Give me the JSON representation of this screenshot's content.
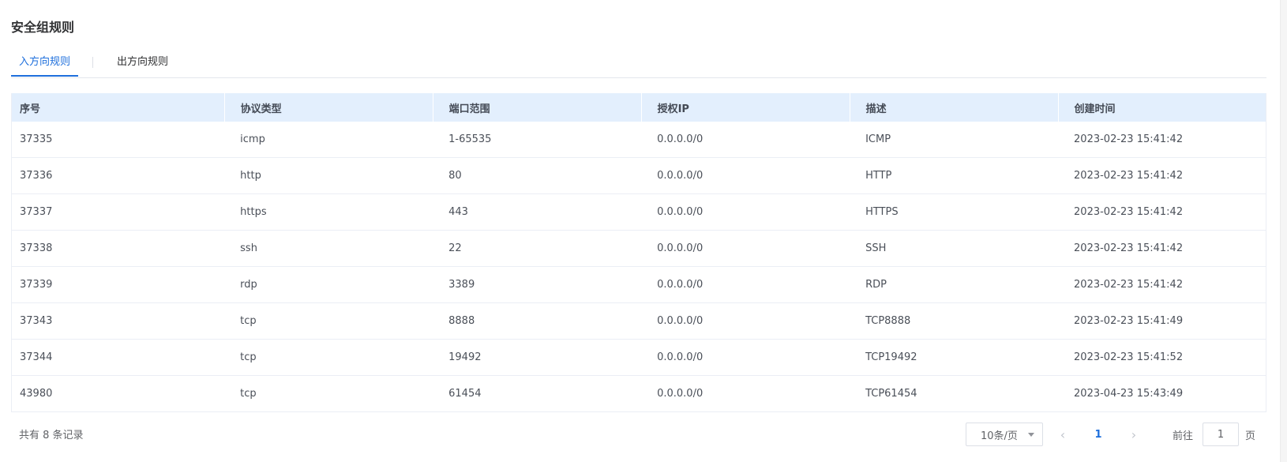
{
  "section": {
    "title": "安全组规则"
  },
  "tabs": [
    {
      "label": "入方向规则",
      "active": true
    },
    {
      "label": "出方向规则",
      "active": false
    }
  ],
  "table": {
    "columns": [
      "序号",
      "协议类型",
      "端口范围",
      "授权IP",
      "描述",
      "创建时间"
    ],
    "rows": [
      [
        "37335",
        "icmp",
        "1-65535",
        "0.0.0.0/0",
        "ICMP",
        "2023-02-23 15:41:42"
      ],
      [
        "37336",
        "http",
        "80",
        "0.0.0.0/0",
        "HTTP",
        "2023-02-23 15:41:42"
      ],
      [
        "37337",
        "https",
        "443",
        "0.0.0.0/0",
        "HTTPS",
        "2023-02-23 15:41:42"
      ],
      [
        "37338",
        "ssh",
        "22",
        "0.0.0.0/0",
        "SSH",
        "2023-02-23 15:41:42"
      ],
      [
        "37339",
        "rdp",
        "3389",
        "0.0.0.0/0",
        "RDP",
        "2023-02-23 15:41:42"
      ],
      [
        "37343",
        "tcp",
        "8888",
        "0.0.0.0/0",
        "TCP8888",
        "2023-02-23 15:41:49"
      ],
      [
        "37344",
        "tcp",
        "19492",
        "0.0.0.0/0",
        "TCP19492",
        "2023-02-23 15:41:52"
      ],
      [
        "43980",
        "tcp",
        "61454",
        "0.0.0.0/0",
        "TCP61454",
        "2023-04-23 15:43:49"
      ]
    ]
  },
  "pagination": {
    "total_text": "共有 8 条记录",
    "page_size": "10条/页",
    "prev_icon": "‹",
    "next_icon": "›",
    "current_page": "1",
    "goto_label": "前往",
    "goto_value": "1",
    "goto_suffix": "页"
  },
  "colors": {
    "accent": "#1e6fdc",
    "header_bg": "#e3effd"
  }
}
